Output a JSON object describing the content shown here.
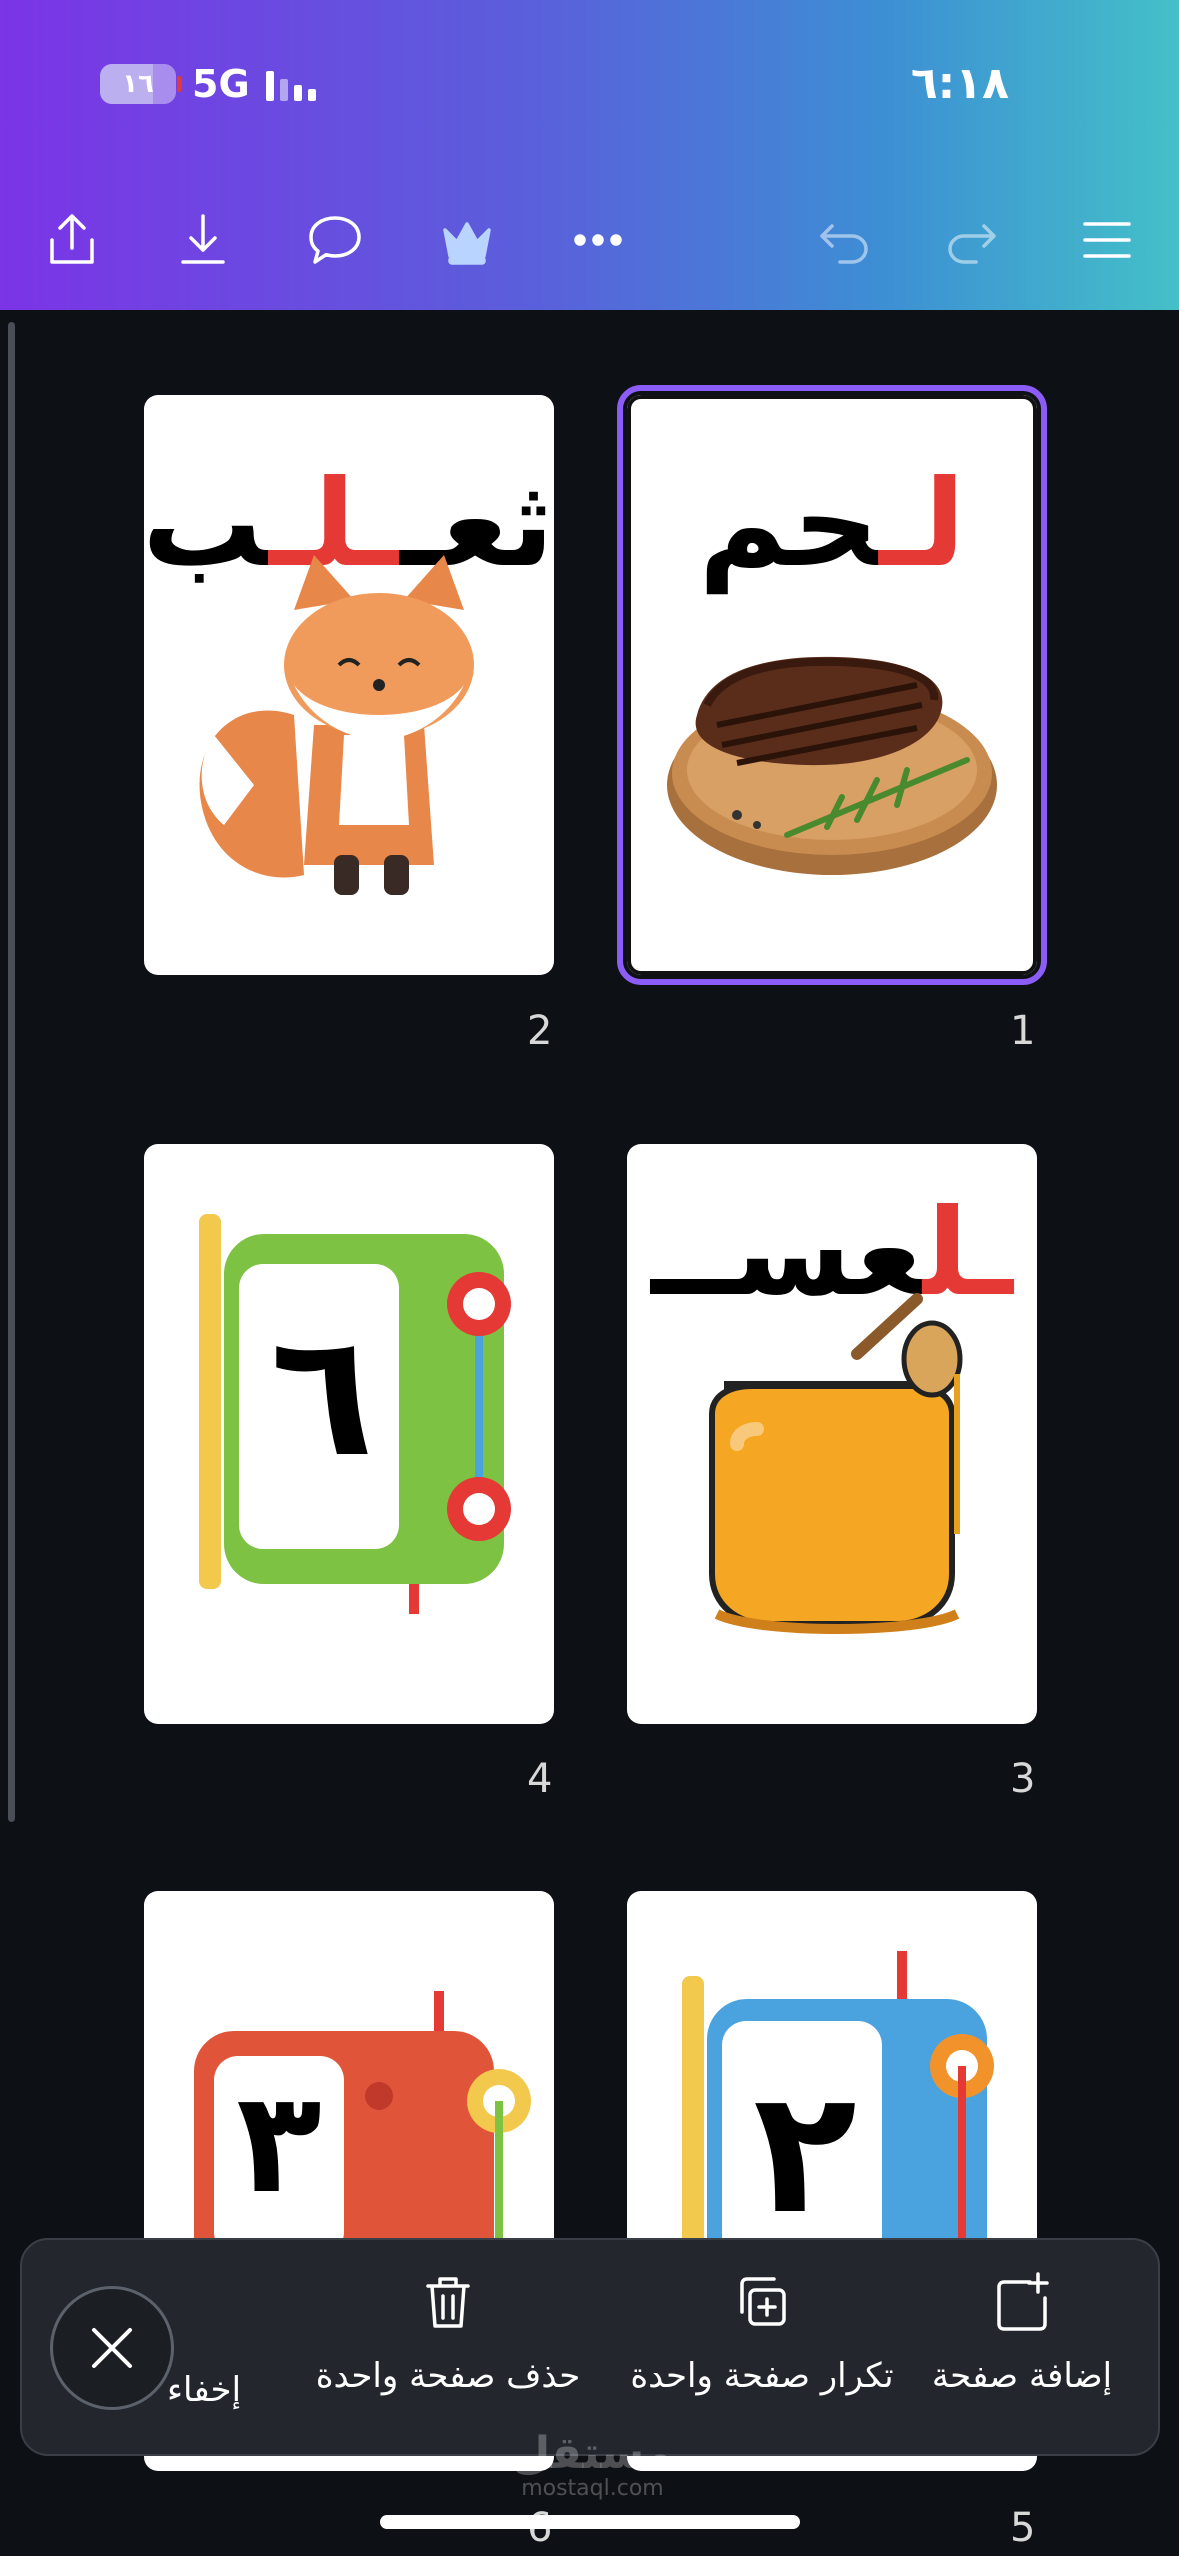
{
  "status_bar": {
    "time": "٦:١٨",
    "battery": "١٦",
    "network": "5G"
  },
  "toolbar": {
    "icons": [
      "share-icon",
      "download-icon",
      "comment-icon",
      "crown-icon",
      "more-icon",
      "undo-icon",
      "redo-icon",
      "menu-icon"
    ]
  },
  "pages": [
    {
      "number": "1",
      "word_black": "حم",
      "word_red": "لـ",
      "image": "steak-on-board",
      "selected": true
    },
    {
      "number": "2",
      "word_black": "ثعـ",
      "word_red": "ـلـ",
      "word_end": "ب",
      "image": "fox",
      "selected": false
    },
    {
      "number": "3",
      "word_black": "عســ",
      "word_red": "ـل",
      "image": "honey-jar",
      "selected": false
    },
    {
      "number": "4",
      "glyph": "٦",
      "image": "green-frame",
      "selected": false
    },
    {
      "number": "5",
      "glyph": "٢",
      "image": "blue-frame",
      "selected": false
    },
    {
      "number": "6",
      "glyph": "٣",
      "image": "red-frame",
      "selected": false
    }
  ],
  "action_bar": {
    "add_page": "إضافة صفحة",
    "duplicate_page": "تكرار صفحة واحدة",
    "delete_page": "حذف صفحة واحدة",
    "hide": "إخفاء"
  },
  "watermark": {
    "arabic": "مستقل",
    "latin": "mostaql.com"
  },
  "colors": {
    "header_gradient_start": "#7b34e6",
    "header_gradient_end": "#44c0c8",
    "selection_outline": "#8b5cf6",
    "accent_red": "#e53935"
  }
}
